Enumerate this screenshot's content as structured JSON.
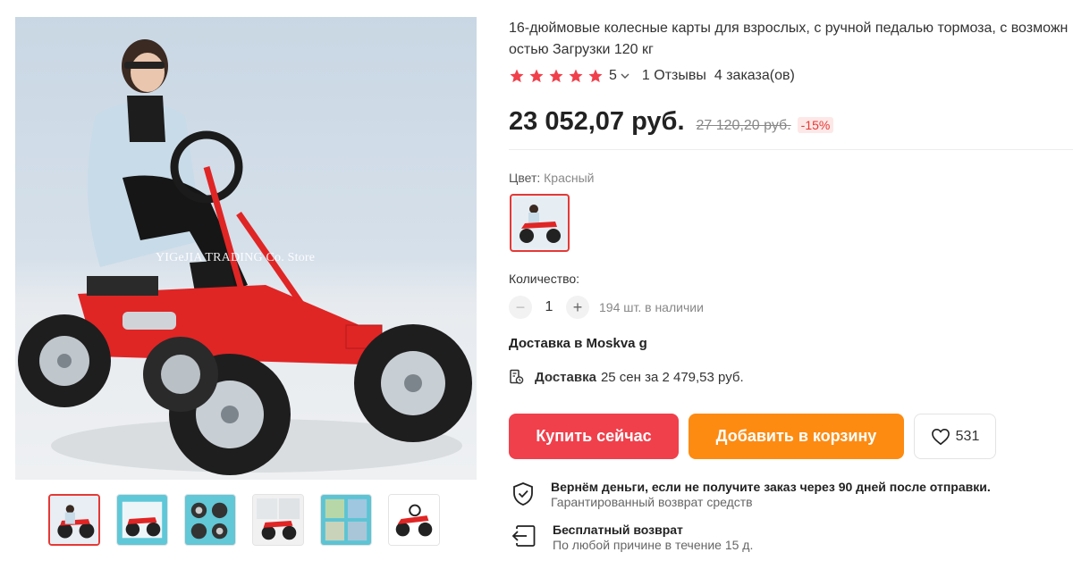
{
  "product": {
    "title": "16-дюймовые колесные карты для взрослых, с ручной педалью тормоза, с возможностью Загрузки 120 кг",
    "rating": "5",
    "reviews": "1 Отзывы",
    "orders": "4 заказа(ов)",
    "price": "23 052,07 руб.",
    "old_price": "27 120,20 руб.",
    "discount": "-15%"
  },
  "gallery": {
    "watermark": "YIGeJIA TRADING Co. Store",
    "thumbnails": 6,
    "active_thumbnail": 1
  },
  "variant": {
    "label": "Цвет:",
    "value": "Красный"
  },
  "quantity": {
    "label": "Количество:",
    "minus": "−",
    "value": "1",
    "plus": "+",
    "stock": "194 шт. в наличии"
  },
  "shipping": {
    "to": "Доставка в Moskva g",
    "label": "Доставка",
    "details": "25 сен за 2 479,53 руб."
  },
  "actions": {
    "buy": "Купить сейчас",
    "cart": "Добавить в корзину",
    "wishlist_count": "531"
  },
  "guarantees": [
    {
      "title": "Вернём деньги, если не получите заказ через 90 дней после отправки.",
      "subtitle": "Гарантированный возврат средств",
      "icon": "shield-check-icon"
    },
    {
      "title": "Бесплатный возврат",
      "subtitle": "По любой причине в течение 15 д.",
      "icon": "return-icon"
    }
  ],
  "colors": {
    "accent_red": "#f0404b",
    "accent_orange": "#fd8b12",
    "star": "#f0404b",
    "discount_bg": "#fde8e7"
  }
}
